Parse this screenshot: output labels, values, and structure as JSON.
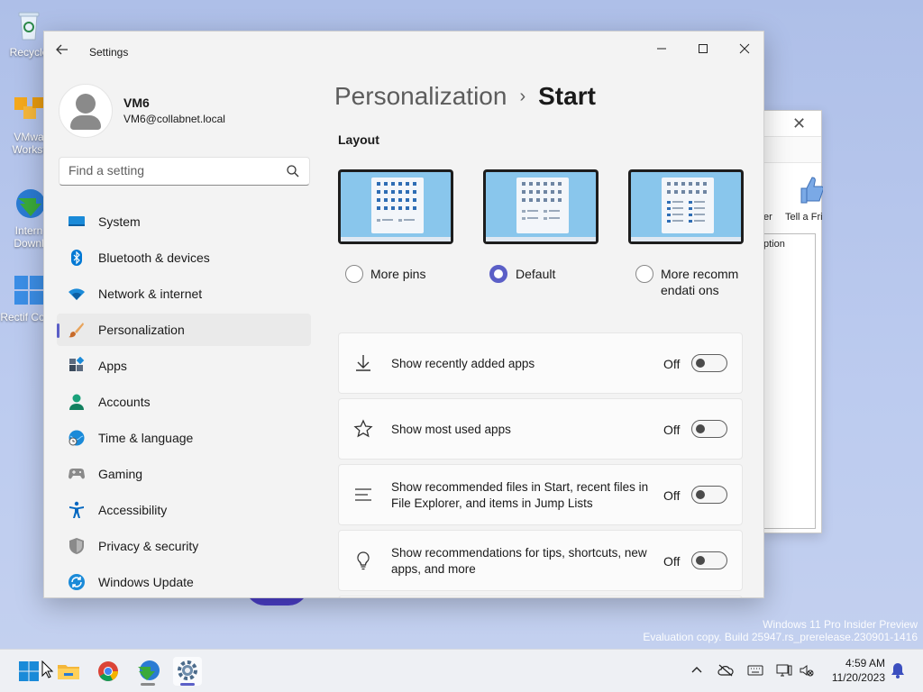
{
  "desktop": {
    "icons": [
      {
        "label": "Recycle",
        "icon": "recycle-bin-icon"
      },
      {
        "label": "VMwa Workst",
        "icon": "vmware-icon"
      },
      {
        "label": "Intern Downl",
        "icon": "idm-icon"
      },
      {
        "label": "Rectif Contr",
        "icon": "rectify-icon"
      }
    ],
    "watermark_line1": "Windows 11 Pro Insider Preview",
    "watermark_line2": "Evaluation copy. Build 25947.rs_prerelease.230901-1416"
  },
  "background_window": {
    "close": "✕",
    "label_er": "er",
    "label_tell": "Tell a Fri",
    "label_option": "ption"
  },
  "settings": {
    "app_title": "Settings",
    "back_icon": "back-arrow-icon",
    "user": {
      "name": "VM6",
      "email": "VM6@collabnet.local"
    },
    "search": {
      "placeholder": "Find a setting"
    },
    "nav": [
      {
        "label": "System",
        "icon": "system-icon",
        "color": "#0067c0"
      },
      {
        "label": "Bluetooth & devices",
        "icon": "bluetooth-icon",
        "color": "#0078d4"
      },
      {
        "label": "Network & internet",
        "icon": "network-icon",
        "color": "#0078d4"
      },
      {
        "label": "Personalization",
        "icon": "personalization-icon",
        "color": "#c76b2b",
        "active": true
      },
      {
        "label": "Apps",
        "icon": "apps-icon",
        "color": "#3a4a5c"
      },
      {
        "label": "Accounts",
        "icon": "accounts-icon",
        "color": "#1aa17a"
      },
      {
        "label": "Time & language",
        "icon": "time-language-icon",
        "color": "#0078d4"
      },
      {
        "label": "Gaming",
        "icon": "gaming-icon",
        "color": "#7a7a7a"
      },
      {
        "label": "Accessibility",
        "icon": "accessibility-icon",
        "color": "#0067c0"
      },
      {
        "label": "Privacy & security",
        "icon": "shield-icon",
        "color": "#7a7a7a"
      },
      {
        "label": "Windows Update",
        "icon": "windows-update-icon",
        "color": "#0078d4"
      }
    ],
    "breadcrumb": {
      "parent": "Personalization",
      "separator": "›",
      "current": "Start"
    },
    "layout": {
      "title": "Layout",
      "options": [
        {
          "label": "More pins",
          "selected": false
        },
        {
          "label": "Default",
          "selected": true
        },
        {
          "label": "More recommendati ons",
          "selected": false
        }
      ]
    },
    "toggles": [
      {
        "label": "Show recently added apps",
        "state": "Off",
        "icon": "download-icon",
        "on": false
      },
      {
        "label": "Show most used apps",
        "state": "Off",
        "icon": "star-icon",
        "on": false
      },
      {
        "label": "Show recommended files in Start, recent files in File Explorer, and items in Jump Lists",
        "state": "Off",
        "icon": "list-icon",
        "on": false
      },
      {
        "label": "Show recommendations for tips, shortcuts, new apps, and more",
        "state": "Off",
        "icon": "lightbulb-icon",
        "on": false
      }
    ],
    "window_controls": {
      "minimize": "—",
      "maximize": "☐",
      "close": "✕"
    }
  },
  "taskbar": {
    "apps": [
      {
        "name": "start",
        "icon": "windows-start-icon"
      },
      {
        "name": "file-explorer",
        "icon": "folder-icon"
      },
      {
        "name": "chrome",
        "icon": "chrome-icon"
      },
      {
        "name": "idm",
        "icon": "idm-icon"
      },
      {
        "name": "settings",
        "icon": "gear-icon",
        "active": true
      }
    ],
    "tray": {
      "chevron": "^"
    },
    "clock": {
      "time": "4:59 AM",
      "date": "11/20/2023"
    }
  }
}
